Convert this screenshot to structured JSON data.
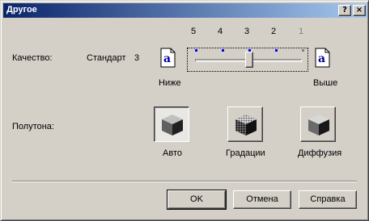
{
  "window": {
    "title": "Другое",
    "help_button": "?",
    "close_button": "×"
  },
  "quality": {
    "label": "Качество:",
    "current_name": "Стандарт",
    "current_value": "3",
    "scale": [
      "5",
      "4",
      "3",
      "2",
      "1"
    ],
    "low_label": "Ниже",
    "high_label": "Выше",
    "slider_value": 3
  },
  "halftone": {
    "label": "Полутона:",
    "options": [
      {
        "label": "Авто",
        "selected": true
      },
      {
        "label": "Градации",
        "selected": false
      },
      {
        "label": "Диффузия",
        "selected": false
      }
    ]
  },
  "buttons": {
    "ok": "OK",
    "cancel": "Отмена",
    "help": "Справка"
  },
  "colors": {
    "title_start": "#0a246a",
    "title_end": "#a6caf0",
    "face": "#d4d0c8",
    "tick_marks": "#0000ff"
  }
}
